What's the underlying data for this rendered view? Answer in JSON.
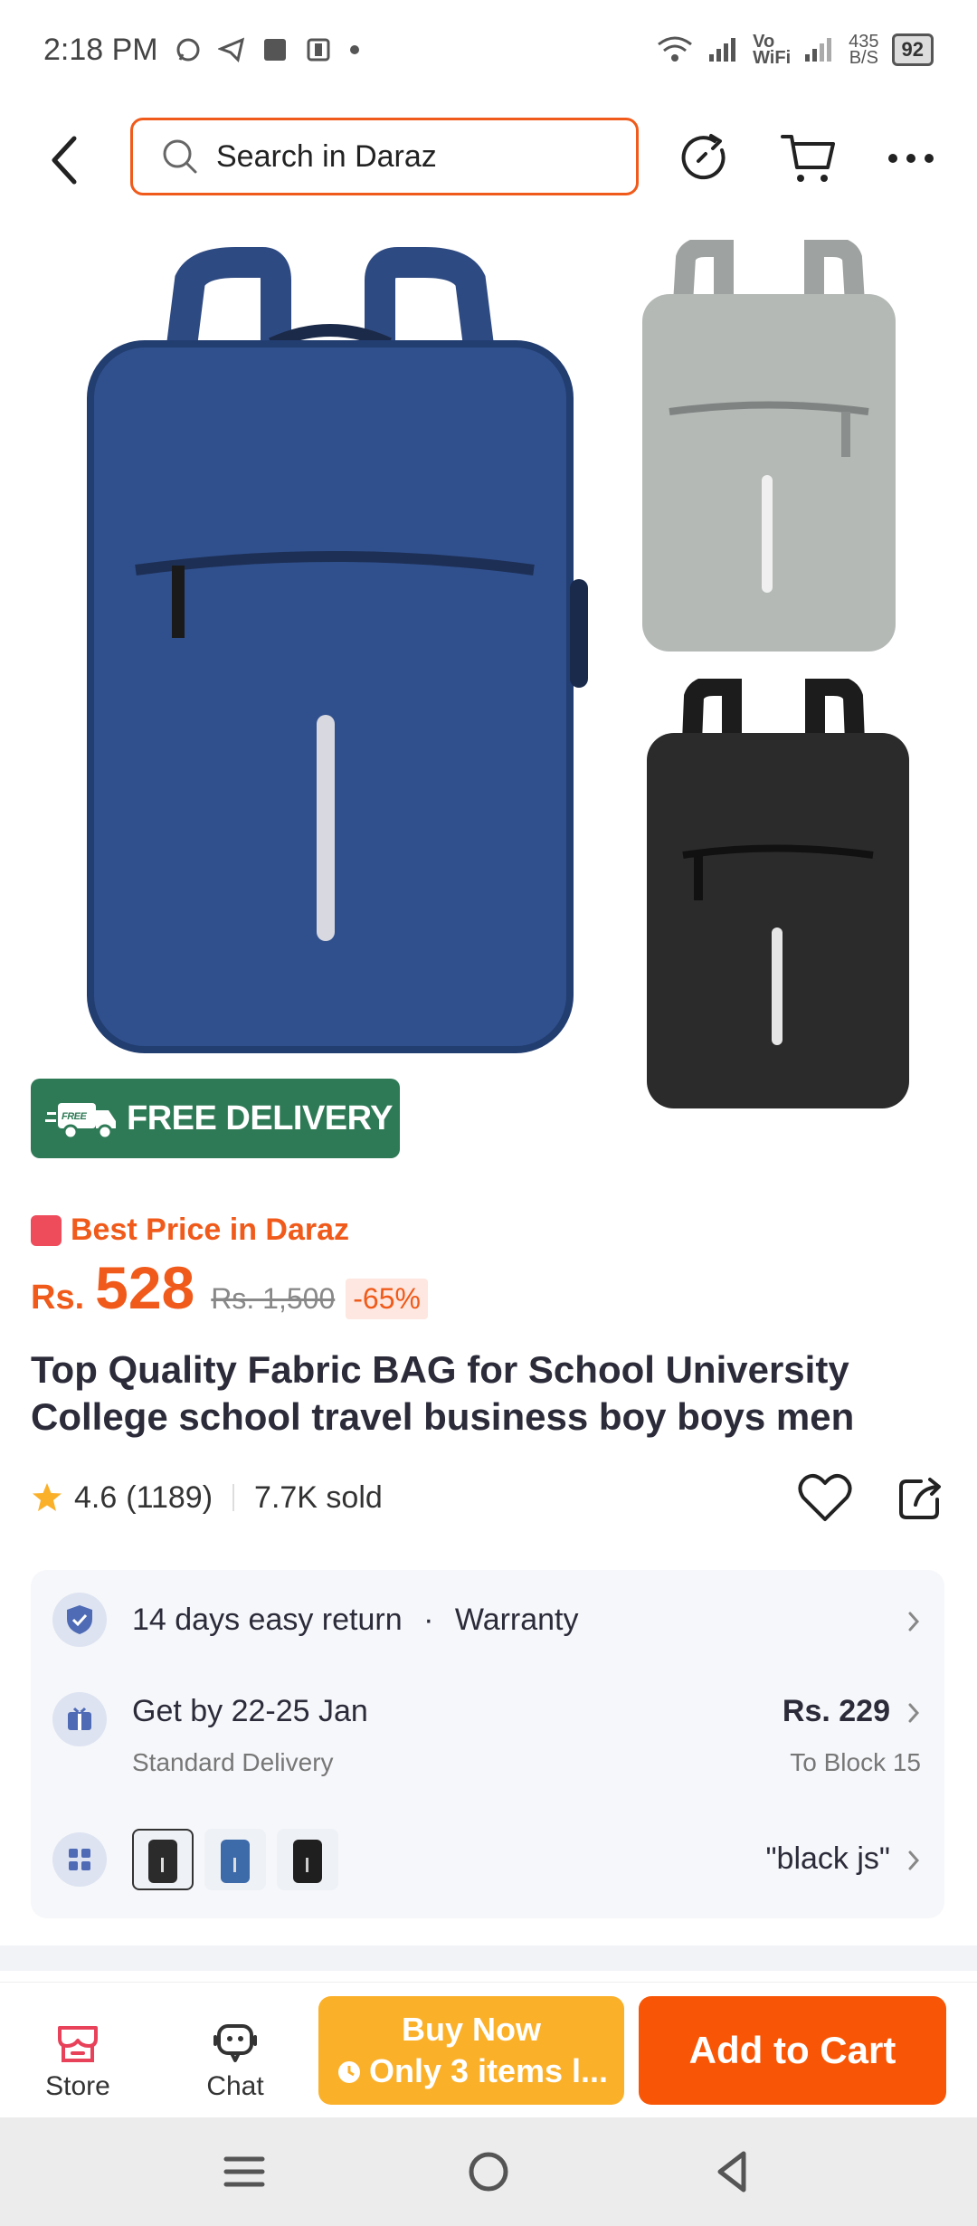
{
  "status_bar": {
    "time": "2:18 PM",
    "net_speed": "435",
    "net_unit": "B/S",
    "battery": "92",
    "vo_label": "Vo",
    "wifi_label": "WiFi"
  },
  "search": {
    "placeholder": "Search in Daraz"
  },
  "product": {
    "free_delivery_badge": "FREE DELIVERY",
    "badge_mini": "FREE",
    "best_price_label": "Best Price in Daraz",
    "currency": "Rs.",
    "price": "528",
    "old_price": "Rs. 1,500",
    "discount": "-65%",
    "title": "Top Quality Fabric BAG for School University College school travel business boy boys men",
    "rating": "4.6",
    "rating_count": "(1189)",
    "sold": "7.7K sold"
  },
  "info": {
    "return_text": "14 days easy return",
    "dot": "·",
    "warranty_text": "Warranty",
    "delivery_text": "Get by 22-25 Jan",
    "delivery_sub": "Standard Delivery",
    "delivery_price": "Rs. 229",
    "delivery_location": "To Block 15",
    "variant_selected": "\"black js\""
  },
  "bottom_bar": {
    "store_label": "Store",
    "chat_label": "Chat",
    "buy_now_label": "Buy Now",
    "buy_now_sub": "Only 3 items l...",
    "add_to_cart_label": "Add to Cart"
  },
  "colors": {
    "accent": "#f85606",
    "buy_now": "#fbb02a",
    "free_badge": "#2f7a56"
  }
}
